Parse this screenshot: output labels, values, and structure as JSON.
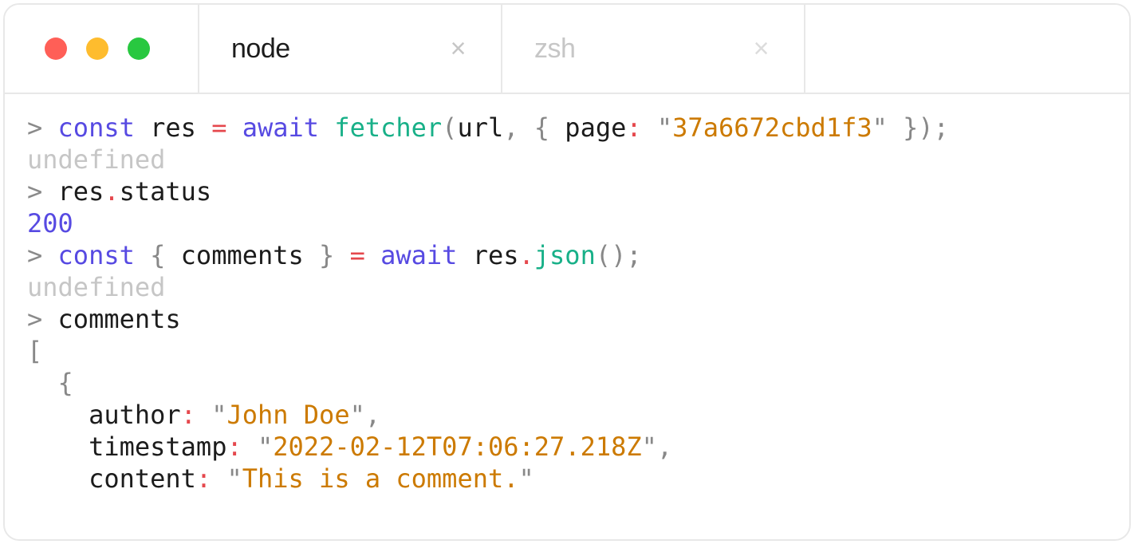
{
  "window": {
    "controls": {
      "close": "red",
      "minimize": "yellow",
      "zoom": "green"
    },
    "tabs": [
      {
        "label": "node",
        "active": true,
        "close": "×"
      },
      {
        "label": "zsh",
        "active": false,
        "close": "×"
      }
    ]
  },
  "terminal": {
    "prompt": ">",
    "lines": {
      "l0": {
        "kw_const": "const",
        "var": "res",
        "eq": "=",
        "kw_await": "await",
        "fn": "fetcher",
        "lparen": "(",
        "arg1": "url",
        "comma": ",",
        "lbrace": "{",
        "key": "page",
        "colon": ":",
        "qopen": "\"",
        "str": "37a6672cbd1f3",
        "qclose": "\"",
        "rbrace": "}",
        "rparen": ")",
        "semi": ";"
      },
      "l1": {
        "text": "undefined"
      },
      "l2": {
        "obj": "res",
        "dot": ".",
        "prop": "status"
      },
      "l3": {
        "text": "200"
      },
      "l4": {
        "kw_const": "const",
        "lbrace": "{",
        "var": "comments",
        "rbrace": "}",
        "eq": "=",
        "kw_await": "await",
        "obj": "res",
        "dot": ".",
        "fn": "json",
        "parens": "()",
        "semi": ";"
      },
      "l5": {
        "text": "undefined"
      },
      "l6": {
        "text": "comments"
      },
      "l7": {
        "text": "["
      },
      "l8": {
        "indent": "  ",
        "text": "{"
      },
      "l9": {
        "indent": "    ",
        "key": "author",
        "colon": ":",
        "qopen": "\"",
        "str": "John Doe",
        "qclose": "\"",
        "comma": ","
      },
      "l10": {
        "indent": "    ",
        "key": "timestamp",
        "colon": ":",
        "qopen": "\"",
        "str": "2022-02-12T07:06:27.218Z",
        "qclose": "\"",
        "comma": ","
      },
      "l11": {
        "indent": "    ",
        "key": "content",
        "colon": ":",
        "qopen": "\"",
        "str": "This is a comment.",
        "qclose": "\""
      }
    }
  }
}
